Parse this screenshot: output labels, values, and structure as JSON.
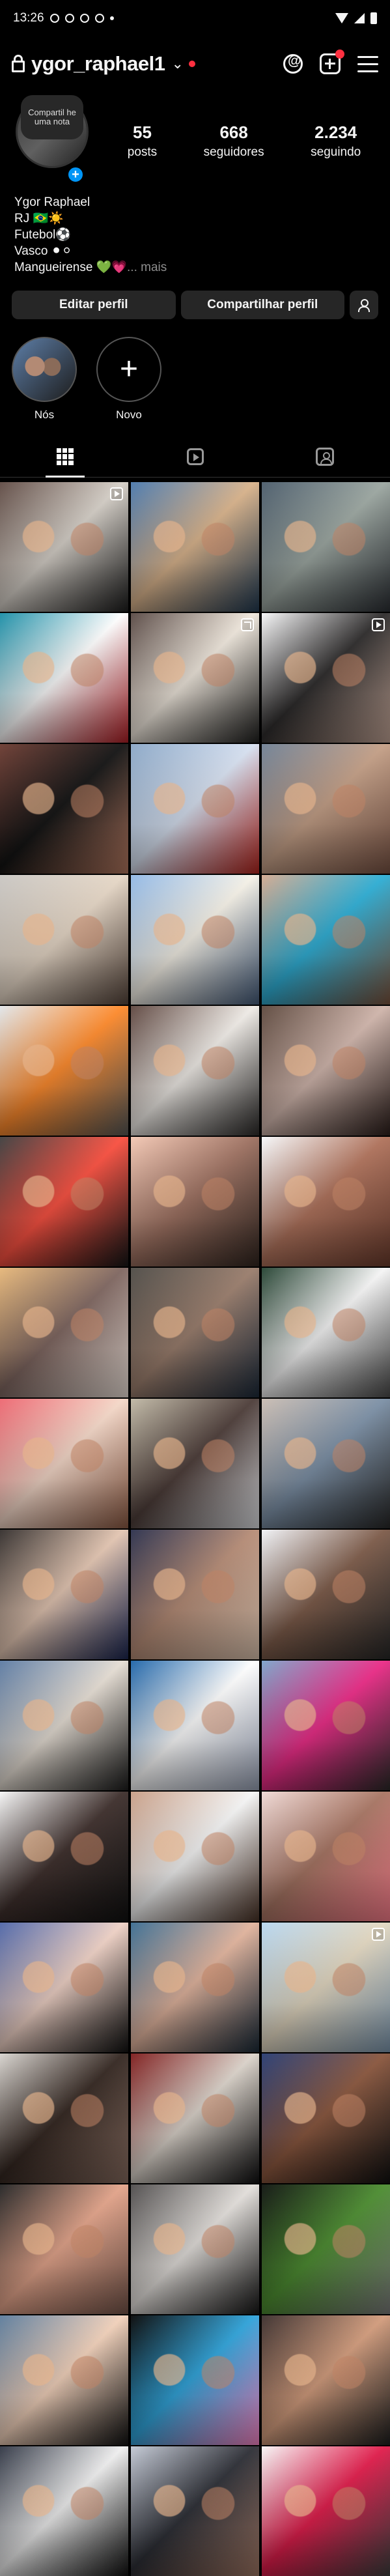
{
  "status_bar": {
    "time": "13:26"
  },
  "profile": {
    "username": "ygor_raphael1",
    "note": "Compartil he uma nota",
    "stats": [
      {
        "value": "55",
        "label": "posts"
      },
      {
        "value": "668",
        "label": "seguidores"
      },
      {
        "value": "2.234",
        "label": "seguindo"
      }
    ],
    "bio": {
      "line1": "Ygor Raphael",
      "line2": "RJ 🇧🇷☀️",
      "line3": "Futebol⚽",
      "line4": "Vasco ⚫⚪",
      "line5": "Mangueirense 💚💗",
      "more": "... mais"
    },
    "buttons": {
      "edit": "Editar perfil",
      "share": "Compartilhar perfil"
    }
  },
  "highlights": [
    {
      "label": "Nós"
    },
    {
      "label": "Novo"
    }
  ],
  "tabs": [
    {
      "name": "posts-grid-tab",
      "icon": "grid-icon"
    },
    {
      "name": "reels-tab",
      "icon": "reels-icon"
    },
    {
      "name": "tagged-tab",
      "icon": "tagged-icon"
    }
  ],
  "posts": [
    {
      "badge": "reel",
      "c1": "#5f4a43",
      "c2": "#d6d0c8",
      "c3": "#1d1d1d"
    },
    {
      "badge": "",
      "c1": "#4978ac",
      "c2": "#d9b38b",
      "c3": "#223b53"
    },
    {
      "badge": "",
      "c1": "#4a5b6a",
      "c2": "#9ca7a1",
      "c3": "#2c3035"
    },
    {
      "badge": "",
      "c1": "#198da6",
      "c2": "#ffffff",
      "c3": "#b41f26"
    },
    {
      "badge": "multi",
      "c1": "#584843",
      "c2": "#f0e8dd",
      "c3": "#20201f"
    },
    {
      "badge": "reel",
      "c1": "#f7f7f8",
      "c2": "#2d2b2b",
      "c3": "#c8a99a"
    },
    {
      "badge": "",
      "c1": "#6b3a30",
      "c2": "#121212",
      "c3": "#b97b62"
    },
    {
      "badge": "",
      "c1": "#8aa7c7",
      "c2": "#d7e1f1",
      "c3": "#b7251e"
    },
    {
      "badge": "",
      "c1": "#6f8094",
      "c2": "#c49f86",
      "c3": "#7a5445"
    },
    {
      "badge": "",
      "c1": "#c9c6c2",
      "c2": "#e6d7c6",
      "c3": "#58473d"
    },
    {
      "badge": "",
      "c1": "#91b8e5",
      "c2": "#f6f2e8",
      "c3": "#465d7c"
    },
    {
      "badge": "",
      "c1": "#d3a98f",
      "c2": "#2daed5",
      "c3": "#7d553e"
    },
    {
      "badge": "",
      "c1": "#e1e6ea",
      "c2": "#ff8a2b",
      "c3": "#5a5a58"
    },
    {
      "badge": "",
      "c1": "#5d453e",
      "c2": "#f0ece7",
      "c3": "#2d2b2a"
    },
    {
      "badge": "",
      "c1": "#5c473c",
      "c2": "#d0b5ab",
      "c3": "#2d1f1c"
    },
    {
      "badge": "",
      "c1": "#3d3d3d",
      "c2": "#fb4f3f",
      "c3": "#161616"
    },
    {
      "badge": "",
      "c1": "#f3c7b3",
      "c2": "#9d7060",
      "c3": "#322620"
    },
    {
      "badge": "",
      "c1": "#f6f8fa",
      "c2": "#b0725b",
      "c3": "#6d3d2e"
    },
    {
      "badge": "",
      "c1": "#e6b678",
      "c2": "#7f6660",
      "c3": "#f2e6de"
    },
    {
      "badge": "",
      "c1": "#4d4a45",
      "c2": "#9a7d6c",
      "c3": "#1d2b3b"
    },
    {
      "badge": "",
      "c1": "#22402f",
      "c2": "#f6f6f6",
      "c3": "#4b4b4b"
    },
    {
      "badge": "",
      "c1": "#ed6670",
      "c2": "#f5d8c8",
      "c3": "#8f5c45"
    },
    {
      "badge": "",
      "c1": "#c0b8a5",
      "c2": "#4c3c38",
      "c3": "#e5e7eb"
    },
    {
      "badge": "",
      "c1": "#c9bcb2",
      "c2": "#7b8fa5",
      "c3": "#282828"
    },
    {
      "badge": "",
      "c1": "#322d2b",
      "c2": "#e4c6b2",
      "c3": "#1b2652"
    },
    {
      "badge": "",
      "c1": "#2a2f4b",
      "c2": "#b68c76",
      "c3": "#e2c9b4"
    },
    {
      "badge": "",
      "c1": "#f0f2f6",
      "c2": "#7d5b49",
      "c3": "#282828"
    },
    {
      "badge": "",
      "c1": "#5b7aa2",
      "c2": "#e6ded4",
      "c3": "#1d1d1d"
    },
    {
      "badge": "",
      "c1": "#1c63a8",
      "c2": "#ffffff",
      "c3": "#9ba4b8"
    },
    {
      "badge": "",
      "c1": "#7ba3c9",
      "c2": "#eb2a86",
      "c3": "#2d2b2a"
    },
    {
      "badge": "",
      "c1": "#f6f6f6",
      "c2": "#3d2e2b",
      "c3": "#111111"
    },
    {
      "badge": "",
      "c1": "#c89e86",
      "c2": "#f6f6f6",
      "c3": "#4a3327"
    },
    {
      "badge": "",
      "c1": "#f0d9d5",
      "c2": "#a87563",
      "c3": "#ff7f8e"
    },
    {
      "badge": "",
      "c1": "#4e65a7",
      "c2": "#f0d2c6",
      "c3": "#111111"
    },
    {
      "badge": "",
      "c1": "#3a6c91",
      "c2": "#e2b49d",
      "c3": "#1b2b39"
    },
    {
      "badge": "reel",
      "c1": "#b7d6ef",
      "c2": "#e3d8c1",
      "c3": "#7f9ab2"
    },
    {
      "badge": "",
      "c1": "#d8d4cf",
      "c2": "#332620",
      "c3": "#8b6f62"
    },
    {
      "badge": "",
      "c1": "#7d1a1a",
      "c2": "#dcd4cb",
      "c3": "#0f0f10"
    },
    {
      "badge": "",
      "c1": "#263a70",
      "c2": "#8a563d",
      "c3": "#111111"
    },
    {
      "badge": "",
      "c1": "#222222",
      "c2": "#e4a48a",
      "c3": "#77564b"
    },
    {
      "badge": "",
      "c1": "#4d4a4a",
      "c2": "#e4e0dc",
      "c3": "#171717"
    },
    {
      "badge": "",
      "c1": "#0d110d",
      "c2": "#4b8c2f",
      "c3": "#7d7d7d"
    },
    {
      "badge": "",
      "c1": "#5b7b9b",
      "c2": "#f3d2bb",
      "c3": "#121212"
    },
    {
      "badge": "",
      "c1": "#050505",
      "c2": "#2ea3da",
      "c3": "#ff87c9"
    },
    {
      "badge": "",
      "c1": "#3a2d2b",
      "c2": "#d39c7c",
      "c3": "#1f1f1f"
    },
    {
      "badge": "",
      "c1": "#2e3442",
      "c2": "#f0f0f0",
      "c3": "#121212"
    },
    {
      "badge": "",
      "c1": "#c3c9d5",
      "c2": "#2c2e35",
      "c3": "#a57a67"
    },
    {
      "badge": "",
      "c1": "#f6f6f6",
      "c2": "#e11b4a",
      "c3": "#404040"
    }
  ]
}
